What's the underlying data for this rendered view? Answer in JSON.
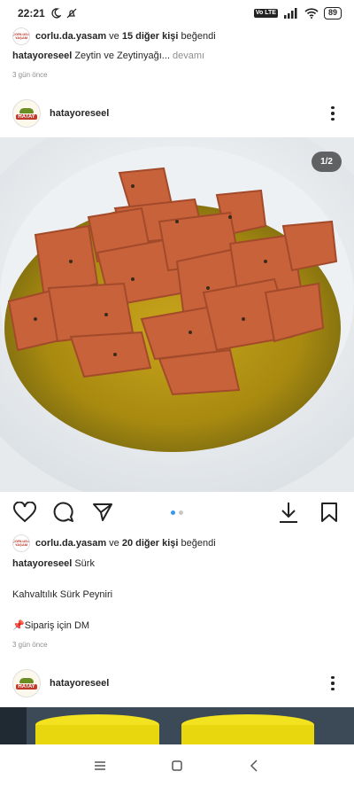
{
  "status_bar": {
    "time": "22:21",
    "battery": "89",
    "network": "Vo LTE"
  },
  "post1_footer": {
    "liked_by_user": "corlu.da.yasam",
    "liked_by_connector": "ve",
    "liked_by_others": "15 diğer kişi",
    "liked_by_suffix": "beğendi",
    "caption_user": "hatayoreseel",
    "caption_text": "Zeytin ve Zeytinyağı...",
    "caption_more": "devamı",
    "time_ago": "3 gün önce"
  },
  "post2": {
    "username": "hatayoreseel",
    "avatar_text": "HATAY",
    "image_counter": "1/2",
    "carousel_index": 1,
    "carousel_total": 2,
    "liked_by_user": "corlu.da.yasam",
    "liked_by_connector": "ve",
    "liked_by_others": "20 diğer kişi",
    "liked_by_suffix": "beğendi",
    "caption_user": "hatayoreseel",
    "caption_line1": "Sürk",
    "caption_line2": "Kahvaltılık Sürk Peyniri",
    "caption_line3_icon": "📌",
    "caption_line3": "Sipariş için DM",
    "time_ago": "3 gün önce"
  },
  "post3": {
    "username": "hatayoreseel",
    "avatar_text": "HATAY"
  },
  "mini_avatar_text": "ÇORLUDA YAŞAM",
  "icons": {
    "like": "heart-icon",
    "comment": "comment-icon",
    "share": "send-icon",
    "download": "download-icon",
    "save": "bookmark-icon",
    "more": "more-vertical-icon",
    "nav_recent": "menu-icon",
    "nav_home": "square-icon",
    "nav_back": "back-icon"
  },
  "colors": {
    "accent": "#3897f0",
    "text": "#262626",
    "muted": "#8e8e8e"
  }
}
